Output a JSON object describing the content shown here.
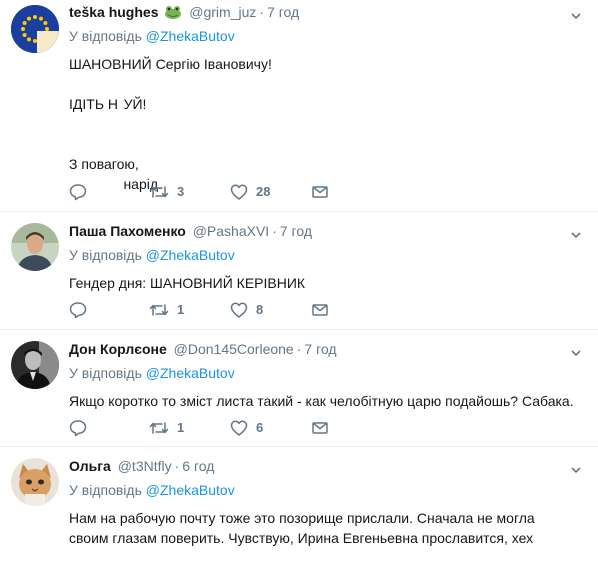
{
  "reply_prefix": "У відповідь",
  "reply_target": "@ZhekaButov",
  "tweets": [
    {
      "name": "teška hughes",
      "handle": "@grim_juz",
      "time": "7 год",
      "text": "ШАНОВНИЙ Сергію Івановичу!\n\nІДІТЬ Н  УЙ!\n\n\nЗ повагою,\n              нарід.",
      "reply_count": "",
      "retweet_count": "3",
      "like_count": "28",
      "avatar_icon": "eu-flag-avatar",
      "name_emoji_icon": "frog-emoji-icon"
    },
    {
      "name": "Паша Пахоменко",
      "handle": "@PashaXVI",
      "time": "7 год",
      "text": "Гендер дня: ШАНОВНИЙ КЕРІВНИК",
      "reply_count": "",
      "retweet_count": "1",
      "like_count": "8",
      "avatar_icon": "user-photo-avatar"
    },
    {
      "name": "Дон Корлєоне",
      "handle": "@Don145Corleone",
      "time": "7 год",
      "text": "Якщо коротко то зміст листа такий - как челобітную царю подайошь? Сабака.",
      "reply_count": "",
      "retweet_count": "1",
      "like_count": "6",
      "avatar_icon": "user-photo-avatar"
    },
    {
      "name": "Ольга",
      "handle": "@t3Ntfly",
      "time": "6 год",
      "text": "Нам на рабочую почту тоже это позорище прислали. Сначала не могла\nсвоим глазам поверить. Чувствую, Ирина Евгеньевна прославится, хех",
      "avatar_icon": "cat-photo-avatar"
    }
  ],
  "colors": {
    "link": "#1b95e0",
    "muted": "#657786",
    "text": "#14171a",
    "divider": "#e6ecf0"
  }
}
